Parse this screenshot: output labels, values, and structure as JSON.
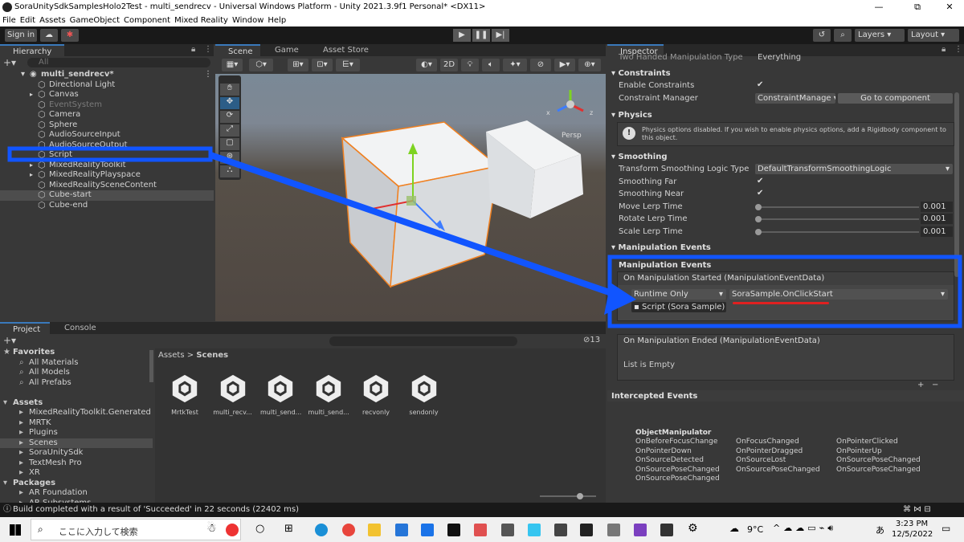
{
  "window": {
    "title": "SoraUnitySdkSamplesHolo2Test - multi_sendrecv - Universal Windows Platform - Unity 2021.3.9f1 Personal* <DX11>",
    "minimize": "—",
    "maximize": "⧉",
    "close": "✕"
  },
  "menu": [
    "File",
    "Edit",
    "Assets",
    "GameObject",
    "Component",
    "Mixed Reality",
    "Window",
    "Help"
  ],
  "toolbar": {
    "sign_in": "Sign in",
    "layers": "Layers",
    "layout": "Layout"
  },
  "hierarchy": {
    "tab": "Hierarchy",
    "search_placeholder": "All",
    "scene_name": "multi_sendrecv*",
    "items": [
      {
        "label": "Directional Light"
      },
      {
        "label": "Canvas"
      },
      {
        "label": "EventSystem"
      },
      {
        "label": "Camera"
      },
      {
        "label": "Sphere"
      },
      {
        "label": "AudioSourceInput"
      },
      {
        "label": "AudioSourceOutput"
      },
      {
        "label": "Script"
      },
      {
        "label": "MixedRealityToolkit"
      },
      {
        "label": "MixedRealityPlayspace"
      },
      {
        "label": "MixedRealitySceneContent"
      },
      {
        "label": "Cube-start"
      },
      {
        "label": "Cube-end"
      }
    ]
  },
  "scene_tabs": {
    "scene": "Scene",
    "game": "Game",
    "asset_store": "Asset Store"
  },
  "scene": {
    "mode_2d": "2D",
    "persp": "Persp",
    "gizmo_x": "x",
    "gizmo_z": "z"
  },
  "project": {
    "tab_project": "Project",
    "tab_console": "Console",
    "breadcrumb_root": "Assets",
    "breadcrumb_sep": ">",
    "breadcrumb_current": "Scenes",
    "count": "13",
    "favorites_label": "Favorites",
    "favorites": [
      "All Materials",
      "All Models",
      "All Prefabs"
    ],
    "assets_label": "Assets",
    "assets": [
      "MixedRealityToolkit.Generated",
      "MRTK",
      "Plugins",
      "Scenes",
      "SoraUnitySdk",
      "TextMesh Pro",
      "XR"
    ],
    "packages_label": "Packages",
    "packages": [
      "AR Foundation",
      "AR Subsystems"
    ],
    "scene_assets": [
      "MrtkTest",
      "multi_recv...",
      "multi_send...",
      "multi_send...",
      "recvonly",
      "sendonly"
    ]
  },
  "inspector": {
    "tab": "Inspector",
    "clipped_label": "Two Handed Manipulation Type",
    "clipped_value": "Everything",
    "constraints_head": "Constraints",
    "enable_constraints": "Enable Constraints",
    "constraint_manager": "Constraint Manager",
    "constraint_manager_value": "ConstraintManage",
    "goto_component": "Go to component",
    "physics_head": "Physics",
    "physics_msg": "Physics options disabled. If you wish to enable physics options, add a Rigidbody component to this object.",
    "smoothing_head": "Smoothing",
    "transform_logic": "Transform Smoothing Logic Type",
    "transform_logic_value": "DefaultTransformSmoothingLogic",
    "smoothing_far": "Smoothing Far",
    "smoothing_near": "Smoothing Near",
    "move_lerp": "Move Lerp Time",
    "rotate_lerp": "Rotate Lerp Time",
    "scale_lerp": "Scale Lerp Time",
    "move_lerp_value": "0.001",
    "rotate_lerp_value": "0.001",
    "scale_lerp_value": "0.001",
    "manip_events_head": "Manipulation Events",
    "manip_events_sub": "Manipulation Events",
    "on_started": "On Manipulation Started (ManipulationEventData)",
    "runtime_only": "Runtime Only",
    "function": "SoraSample.OnClickStart",
    "script_ref": "Script (Sora Sample)",
    "on_ended": "On Manipulation Ended (ManipulationEventData)",
    "list_empty": "List is Empty",
    "plus": "+",
    "minus": "−",
    "intercepted_head": "Intercepted Events",
    "object_manipulator": "ObjectManipulator",
    "events_col1": [
      "OnBeforeFocusChange",
      "OnPointerDown",
      "OnSourceDetected",
      "OnSourcePoseChanged",
      "OnSourcePoseChanged"
    ],
    "events_col2": [
      "OnFocusChanged",
      "OnPointerDragged",
      "OnSourceLost",
      "OnSourcePoseChanged"
    ],
    "events_col3": [
      "OnPointerClicked",
      "OnPointerUp",
      "OnSourcePoseChanged",
      "OnSourcePoseChanged"
    ]
  },
  "status": {
    "message": "Build completed with a result of 'Succeeded' in 22 seconds (22402 ms)"
  },
  "taskbar": {
    "search_placeholder": "ここに入力して検索",
    "temperature": "9°C",
    "time": "3:23 PM",
    "date": "12/5/2022"
  },
  "colors": {
    "annotation_blue": "#1155ff",
    "underline_red": "#e02020",
    "selection": "#2c5d87"
  }
}
